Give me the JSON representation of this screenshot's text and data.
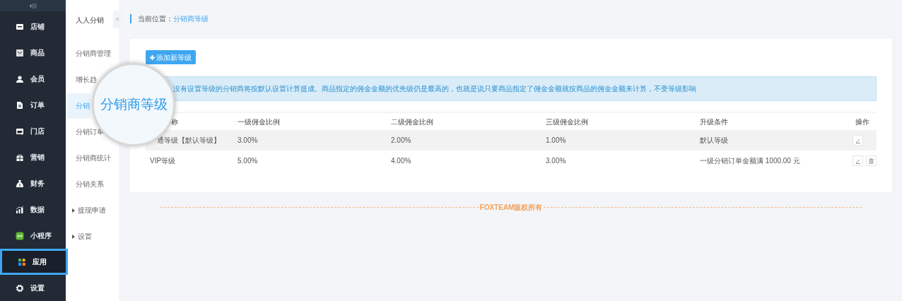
{
  "sidebar": {
    "items": [
      {
        "label": "店铺",
        "selected": false
      },
      {
        "label": "商品",
        "selected": false
      },
      {
        "label": "会员",
        "selected": false
      },
      {
        "label": "订单",
        "selected": false
      },
      {
        "label": "门店",
        "selected": false
      },
      {
        "label": "营销",
        "selected": false
      },
      {
        "label": "财务",
        "selected": false
      },
      {
        "label": "数据",
        "selected": false
      },
      {
        "label": "小程序",
        "selected": false
      },
      {
        "label": "应用",
        "selected": true
      },
      {
        "label": "设置",
        "selected": false
      }
    ]
  },
  "submenu": {
    "title": "人人分销",
    "collapse": "«",
    "items": [
      {
        "label": "分销商管理",
        "kind": "link",
        "selected": false
      },
      {
        "label": "增长趋",
        "kind": "link",
        "selected": false
      },
      {
        "label": "分销",
        "kind": "link",
        "selected": true
      },
      {
        "label": "分销订单",
        "kind": "link",
        "selected": false
      },
      {
        "label": "分销商统计",
        "kind": "link",
        "selected": false
      },
      {
        "label": "分销关系",
        "kind": "link",
        "selected": false
      },
      {
        "label": "提现申请",
        "kind": "group",
        "selected": false
      },
      {
        "label": "设置",
        "kind": "group",
        "selected": false
      }
    ]
  },
  "breadcrumb": {
    "label": "当前位置：",
    "current": "分销商等级"
  },
  "add_button": "添加新等级",
  "notice": "没有设置等级的分销商将按默认设置计算提成。商品指定的佣金金额的优先级仍是最高的，也就是说只要商品指定了佣金金额就按商品的佣金金额来计算，不受等级影响",
  "table": {
    "columns": [
      "称",
      "一级佣金比例",
      "二级佣金比例",
      "三级佣金比例",
      "升级条件",
      "操作"
    ],
    "rows": [
      {
        "cells": [
          "通等级【默认等级】",
          "3.00%",
          "2.00%",
          "1.00%",
          "默认等级"
        ],
        "deletable": false,
        "highlighted": true
      },
      {
        "cells": [
          "VIP等级",
          "5.00%",
          "4.00%",
          "3.00%",
          "一级分销订单金额满 1000.00 元"
        ],
        "deletable": true,
        "highlighted": false
      }
    ]
  },
  "magnifier": "分销商等级",
  "footer": "FOXTEAM版权所有"
}
